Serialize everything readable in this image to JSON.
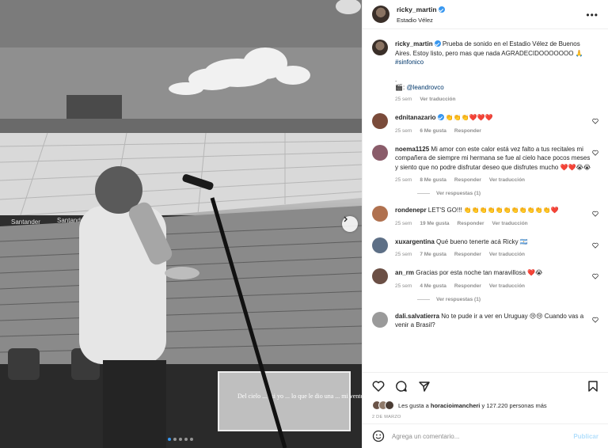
{
  "post": {
    "username": "ricky_martin",
    "location": "Estadio Vélez",
    "more_icon": "more-icon"
  },
  "caption": {
    "username": "ricky_martin",
    "text": "Prueba de sonido en el Estadio Vélez de Buenos Aires. Estoy listo, pero mas que nada AGRADECIDOOOOOOO 🙏",
    "hashtag": "#sinfonico",
    "dot": ".",
    "credit_icon": "🎬",
    "credit_sep": ":",
    "credit_handle": "@leandrovco",
    "time": "25 sem",
    "translate": "Ver traducción"
  },
  "comments": [
    {
      "user": "ednitanazario",
      "verified": true,
      "text": "👏👏👏❤️❤️❤️",
      "time": "25 sem",
      "likes": "6 Me gusta",
      "reply": "Responder",
      "translate": "",
      "avatar_color": "#7a4b3a"
    },
    {
      "user": "noema1125",
      "verified": false,
      "text": "Mi amor con este calor está vez falto a tus recitales mi compañera de siempre mi hermana se fue al cielo hace pocos meses y siento que no podre disfrutar deseo que disfrutes mucho ❤️❤️😭😭",
      "time": "25 sem",
      "likes": "8 Me gusta",
      "reply": "Responder",
      "translate": "Ver traducción",
      "replies": "Ver respuestas (1)",
      "avatar_color": "#8a5c6a"
    },
    {
      "user": "rondenepr",
      "verified": false,
      "text": "LET'S GO!!! 👏👏👏👏👏👏👏👏👏👏👏❤️",
      "time": "25 sem",
      "likes": "19 Me gusta",
      "reply": "Responder",
      "translate": "Ver traducción",
      "avatar_color": "#b0714f"
    },
    {
      "user": "xuxargentina",
      "verified": false,
      "text": "Qué bueno tenerte acá Ricky 🇦🇷",
      "time": "25 sem",
      "likes": "7 Me gusta",
      "reply": "Responder",
      "translate": "Ver traducción",
      "avatar_color": "#5d6f86"
    },
    {
      "user": "an_rm",
      "verified": false,
      "text": "Gracias por esta noche tan maravillosa ❤️😭",
      "time": "25 sem",
      "likes": "4 Me gusta",
      "reply": "Responder",
      "translate": "Ver traducción",
      "replies": "Ver respuestas (1)",
      "avatar_color": "#6b4f45"
    },
    {
      "user": "dali.salvatierra",
      "verified": false,
      "text": "No te pude ir a ver en Uruguay 😢😢 Cuando vas a venir a Brasil?",
      "time": "",
      "likes": "",
      "reply": "",
      "translate": "",
      "avatar_color": "#9a9a9a"
    }
  ],
  "actions": {
    "likes_text": "Les gusta a",
    "likes_user": "horacioimancheri",
    "likes_rest": "y 127.220 personas más",
    "date": "2 DE MARZO"
  },
  "composer": {
    "placeholder": "Agrega un comentario...",
    "post_label": "Publicar"
  },
  "photo": {
    "banner_left": "Santander",
    "banner_right": "Santander",
    "screen_text": "Del cielo ... fui yo ... lo que le dio una ... mi ventera"
  },
  "colors": {
    "verified": "#3897f0",
    "link": "#00376b",
    "muted": "#8e8e8e",
    "publish_disabled": "#b2dffc"
  }
}
